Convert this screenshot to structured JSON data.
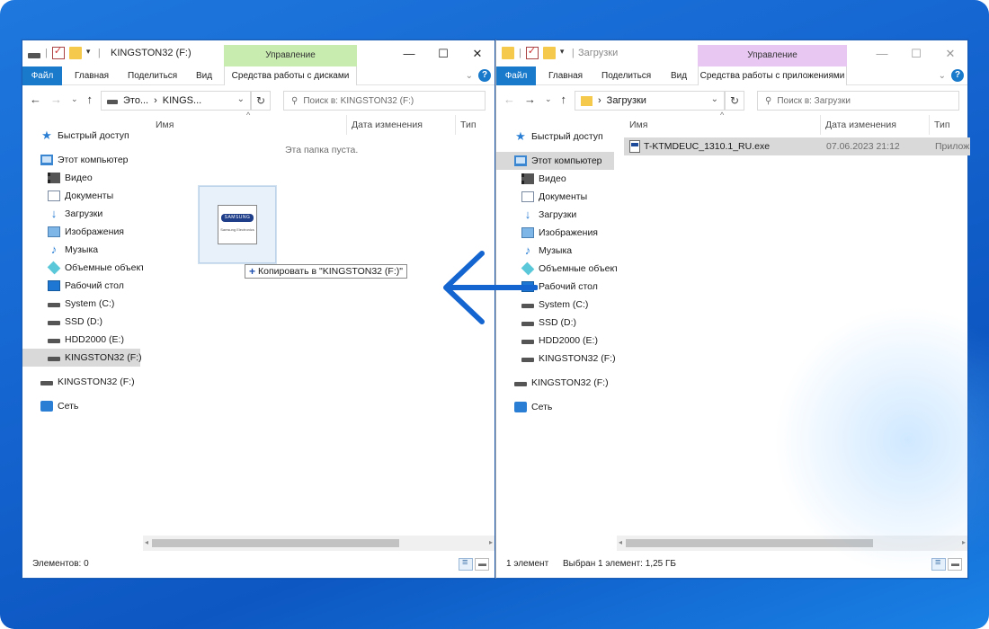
{
  "left_window": {
    "title": "KINGSTON32 (F:)",
    "manage_tab": "Управление",
    "tabs": {
      "file": "Файл",
      "home": "Главная",
      "share": "Поделиться",
      "view": "Вид",
      "tools": "Средства работы с дисками"
    },
    "address": {
      "part1": "Это...",
      "part2": "KINGS..."
    },
    "search_placeholder": "Поиск в: KINGSTON32 (F:)",
    "columns": {
      "name": "Имя",
      "date": "Дата изменения",
      "type": "Тип"
    },
    "empty_text": "Эта папка пуста.",
    "nav": {
      "quick_access": "Быстрый доступ",
      "this_pc": "Этот компьютер",
      "video": "Видео",
      "documents": "Документы",
      "downloads": "Загрузки",
      "images": "Изображения",
      "music": "Музыка",
      "objects3d": "Объемные объекты",
      "desktop": "Рабочий стол",
      "system_c": "System (C:)",
      "ssd_d": "SSD (D:)",
      "hdd_e": "HDD2000 (E:)",
      "kingston_f": "KINGSTON32 (F:)",
      "kingston_root": "KINGSTON32 (F:)",
      "network": "Сеть"
    },
    "status": "Элементов: 0"
  },
  "right_window": {
    "title": "Загрузки",
    "manage_tab": "Управление",
    "tabs": {
      "file": "Файл",
      "home": "Главная",
      "share": "Поделиться",
      "view": "Вид",
      "tools": "Средства работы с приложениями"
    },
    "address": {
      "part1": "Загрузки"
    },
    "search_placeholder": "Поиск в: Загрузки",
    "columns": {
      "name": "Имя",
      "date": "Дата изменения",
      "type": "Тип"
    },
    "file": {
      "name": "T-KTMDEUC_1310.1_RU.exe",
      "date": "07.06.2023 21:12",
      "type": "Прилож"
    },
    "nav": {
      "quick_access": "Быстрый доступ",
      "this_pc": "Этот компьютер",
      "video": "Видео",
      "documents": "Документы",
      "downloads": "Загрузки",
      "images": "Изображения",
      "music": "Музыка",
      "objects3d": "Объемные объекты",
      "desktop": "Рабочий стол",
      "system_c": "System (C:)",
      "ssd_d": "SSD (D:)",
      "hdd_e": "HDD2000 (E:)",
      "kingston_f": "KINGSTON32 (F:)",
      "kingston_root": "KINGSTON32 (F:)",
      "network": "Сеть"
    },
    "status_count": "1 элемент",
    "status_selected": "Выбран 1 элемент: 1,25 ГБ"
  },
  "drag": {
    "tooltip": "Копировать в \"KINGSTON32 (F:)\"",
    "logo_brand": "SAMSUNG",
    "logo_sub": "Samsung Electronics"
  },
  "colors": {
    "accent": "#1979ca",
    "arrow": "#1565d0",
    "manage_left": "#c8ecb0",
    "manage_right": "#e8c8f2"
  }
}
